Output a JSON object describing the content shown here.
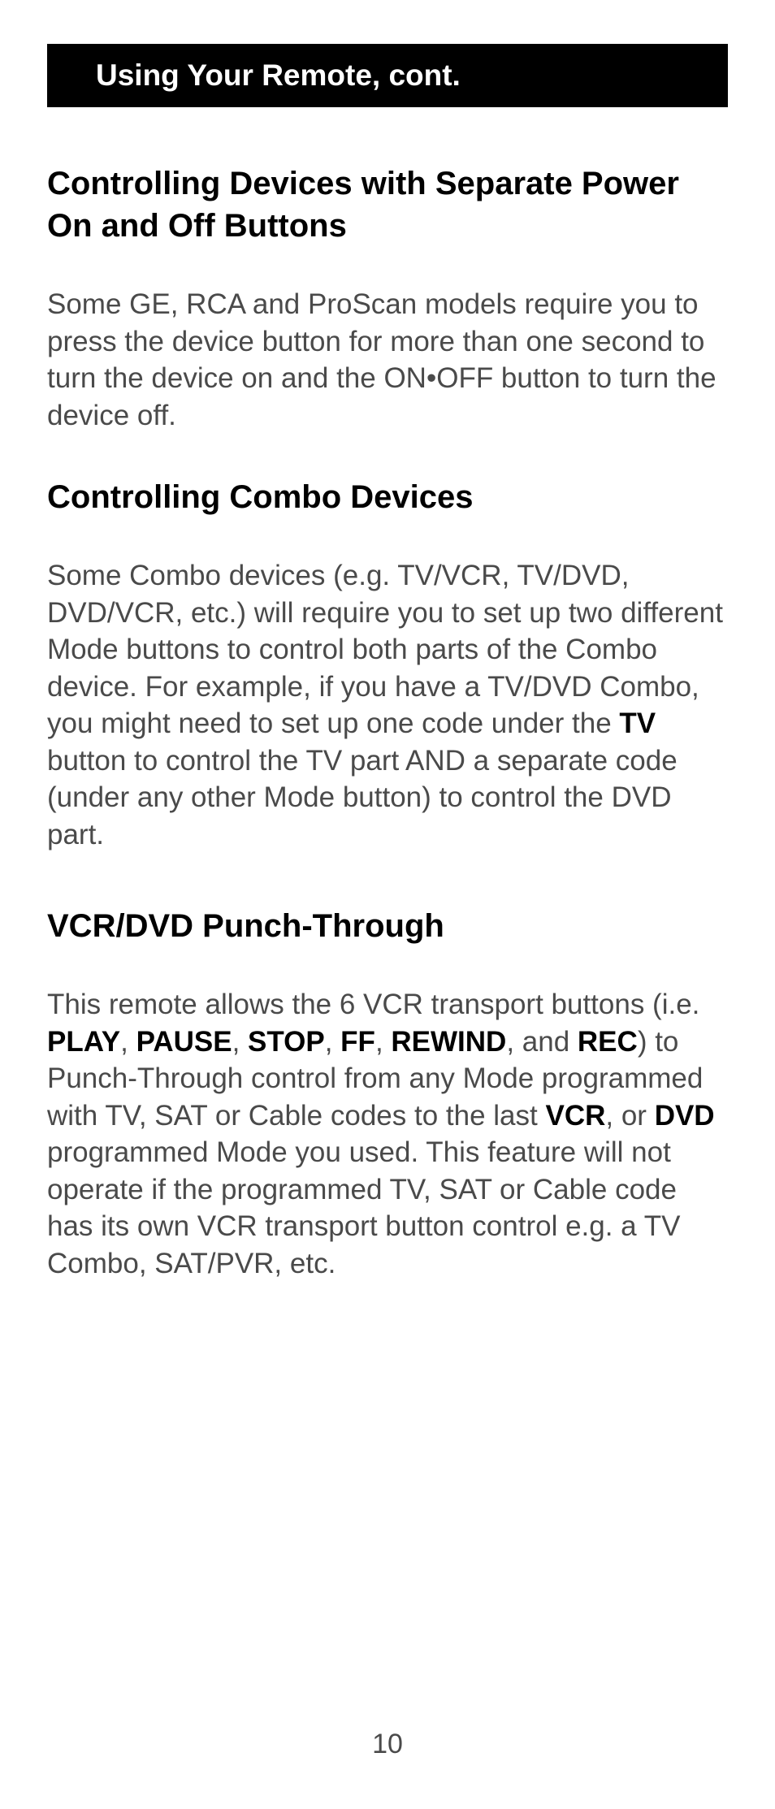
{
  "header": {
    "title": "Using Your Remote, cont."
  },
  "sections": [
    {
      "title": "Controlling Devices with Separate Power On and Off Buttons",
      "body_parts": [
        {
          "text": "Some GE, RCA and ProScan models require you to press the device button for more than one second to turn the device on and the ON•OFF button to turn the device off.",
          "bold": false
        }
      ]
    },
    {
      "title": "Controlling Combo Devices",
      "body_parts": [
        {
          "text": "Some Combo devices (e.g. TV/VCR, TV/DVD, DVD/VCR, etc.) will require you to set up two different Mode buttons to control both parts of the Combo device. For example, if you have a TV/DVD Combo, you might need to set up one code under the ",
          "bold": false
        },
        {
          "text": "TV",
          "bold": true
        },
        {
          "text": " button to control the TV part AND a separate code (under any other Mode button) to control the DVD part.",
          "bold": false
        }
      ]
    },
    {
      "title": "VCR/DVD Punch-Through",
      "body_parts": [
        {
          "text": "This remote allows the 6 VCR transport buttons (i.e. ",
          "bold": false
        },
        {
          "text": "PLAY",
          "bold": true
        },
        {
          "text": ", ",
          "bold": false
        },
        {
          "text": "PAUSE",
          "bold": true
        },
        {
          "text": ", ",
          "bold": false
        },
        {
          "text": "STOP",
          "bold": true
        },
        {
          "text": ", ",
          "bold": false
        },
        {
          "text": "FF",
          "bold": true
        },
        {
          "text": ", ",
          "bold": false
        },
        {
          "text": "REWIND",
          "bold": true
        },
        {
          "text": ", and ",
          "bold": false
        },
        {
          "text": "REC",
          "bold": true
        },
        {
          "text": ") to Punch-Through control from any Mode programmed with TV, SAT or Cable codes to the last ",
          "bold": false
        },
        {
          "text": "VCR",
          "bold": true
        },
        {
          "text": ", or ",
          "bold": false
        },
        {
          "text": "DVD",
          "bold": true
        },
        {
          "text": " programmed Mode you used. This feature will not operate if the programmed TV, SAT or Cable code has its own VCR transport button control e.g. a TV Combo, SAT/PVR, etc.",
          "bold": false
        }
      ]
    }
  ],
  "page_number": "10"
}
